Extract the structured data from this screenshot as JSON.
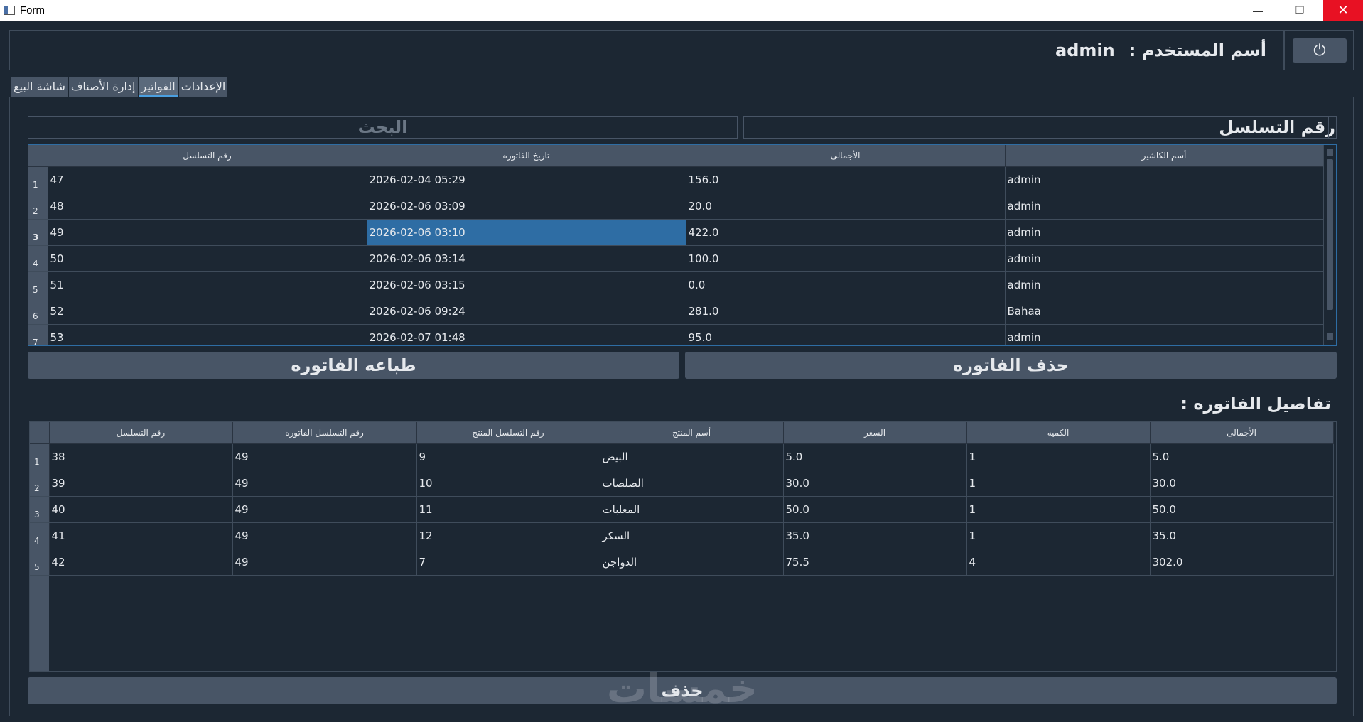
{
  "window": {
    "title": "Form",
    "minimize_glyph": "—",
    "maximize_glyph": "❐",
    "close_glyph": "✕"
  },
  "header": {
    "label": "أسم المستخدم :",
    "username": "admin",
    "power_icon": "power-icon"
  },
  "tabs": [
    "الإعدادات",
    "الفواتير",
    "إدارة الأصناف",
    "شاشة البيع"
  ],
  "active_tab": "الفواتير",
  "search": {
    "placeholder": "البحث",
    "serial_label": "رقم التسلسل"
  },
  "invoices": {
    "columns": [
      "رقم التسلسل",
      "تاريخ الفاتوره",
      "الأجمالى",
      "أسم الكاشير"
    ],
    "rows": [
      {
        "n": "1",
        "serial": "47",
        "date": "2026-02-04 05:29",
        "total": "156.0",
        "cashier": "admin"
      },
      {
        "n": "2",
        "serial": "48",
        "date": "2026-02-06 03:09",
        "total": "20.0",
        "cashier": "admin"
      },
      {
        "n": "3",
        "serial": "49",
        "date": "2026-02-06 03:10",
        "total": "422.0",
        "cashier": "admin"
      },
      {
        "n": "4",
        "serial": "50",
        "date": "2026-02-06 03:14",
        "total": "100.0",
        "cashier": "admin"
      },
      {
        "n": "5",
        "serial": "51",
        "date": "2026-02-06 03:15",
        "total": "0.0",
        "cashier": "admin"
      },
      {
        "n": "6",
        "serial": "52",
        "date": "2026-02-06 09:24",
        "total": "281.0",
        "cashier": "Bahaa"
      },
      {
        "n": "7",
        "serial": "53",
        "date": "2026-02-07 01:48",
        "total": "95.0",
        "cashier": "admin"
      }
    ],
    "selected_row": 3
  },
  "buttons": {
    "print": "طباعه الفاتوره",
    "delete_invoice": "حذف الفاتوره",
    "delete": "حذف"
  },
  "details": {
    "label": "تفاصيل الفاتوره :",
    "columns": [
      "رقم التسلسل",
      "رقم التسلسل الفاتوره",
      "رقم التسلسل المنتج",
      "أسم المنتج",
      "السعر",
      "الكميه",
      "الأجمالى"
    ],
    "rows": [
      {
        "n": "1",
        "serial": "38",
        "invoice": "49",
        "product_id": "9",
        "name": "البيض",
        "price": "5.0",
        "qty": "1",
        "total": "5.0"
      },
      {
        "n": "2",
        "serial": "39",
        "invoice": "49",
        "product_id": "10",
        "name": "الصلصات",
        "price": "30.0",
        "qty": "1",
        "total": "30.0"
      },
      {
        "n": "3",
        "serial": "40",
        "invoice": "49",
        "product_id": "11",
        "name": "المعلبات",
        "price": "50.0",
        "qty": "1",
        "total": "50.0"
      },
      {
        "n": "4",
        "serial": "41",
        "invoice": "49",
        "product_id": "12",
        "name": "السكر",
        "price": "35.0",
        "qty": "1",
        "total": "35.0"
      },
      {
        "n": "5",
        "serial": "42",
        "invoice": "49",
        "product_id": "7",
        "name": "الدواجن",
        "price": "75.5",
        "qty": "4",
        "total": "302.0"
      }
    ]
  },
  "watermark": "خمسات"
}
